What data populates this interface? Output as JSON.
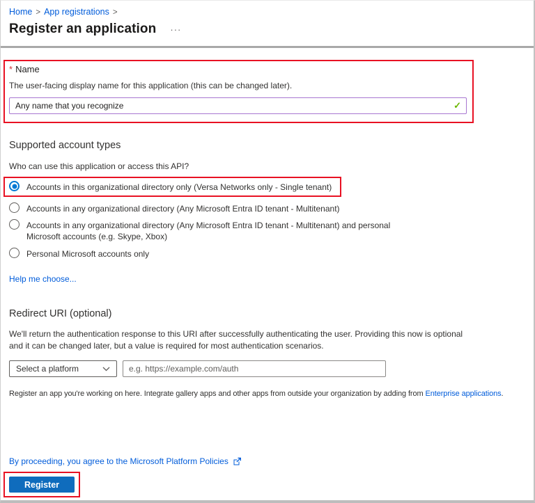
{
  "breadcrumb": {
    "items": [
      {
        "label": "Home"
      },
      {
        "label": "App registrations"
      }
    ],
    "separator": ">"
  },
  "header": {
    "title": "Register an application",
    "ellipsis": "···"
  },
  "name_section": {
    "required_marker": "*",
    "label": "Name",
    "description": "The user-facing display name for this application (this can be changed later).",
    "input_value": "Any name that you recognize",
    "valid_icon": "✓"
  },
  "account_types": {
    "heading": "Supported account types",
    "question": "Who can use this application or access this API?",
    "options": [
      {
        "label": "Accounts in this organizational directory only (Versa Networks only - Single tenant)",
        "selected": true
      },
      {
        "label": "Accounts in any organizational directory (Any Microsoft Entra ID tenant - Multitenant)",
        "selected": false
      },
      {
        "label": "Accounts in any organizational directory (Any Microsoft Entra ID tenant - Multitenant) and personal Microsoft accounts (e.g. Skype, Xbox)",
        "selected": false
      },
      {
        "label": "Personal Microsoft accounts only",
        "selected": false
      }
    ],
    "help_link": "Help me choose..."
  },
  "redirect_uri": {
    "heading": "Redirect URI (optional)",
    "description": "We'll return the authentication response to this URI after successfully authenticating the user. Providing this now is optional and it can be changed later, but a value is required for most authentication scenarios.",
    "platform_select_value": "Select a platform",
    "uri_placeholder": "e.g. https://example.com/auth"
  },
  "enterprise_note": {
    "text_before": "Register an app you're working on here. Integrate gallery apps and other apps from outside your organization by adding from ",
    "link": "Enterprise applications",
    "text_after": "."
  },
  "footer": {
    "policies_text": "By proceeding, you agree to the Microsoft Platform Policies",
    "register_button": "Register"
  },
  "colors": {
    "accent": "#0078d4",
    "link": "#015cda",
    "annotation_red": "#e81123",
    "valid_green": "#6bb700",
    "focused_input_purple": "#a776d1",
    "register_button_blue": "#0f6cbd"
  }
}
